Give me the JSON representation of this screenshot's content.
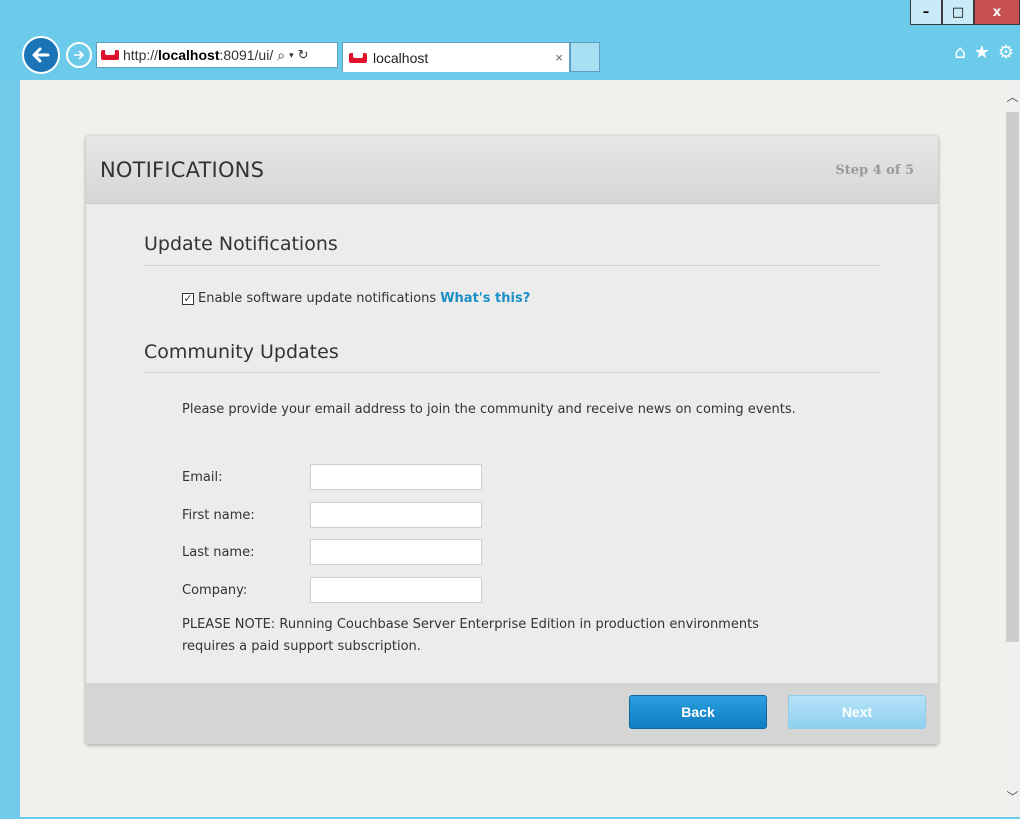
{
  "browser": {
    "address_prefix": "http://",
    "address_host": "localhost",
    "address_rest": ":8091/ui/",
    "search_icon": "magnifier-icon",
    "tab_title": "localhost",
    "tab_close": "×",
    "window_controls": {
      "minimize": "–",
      "maximize": "□",
      "close": "x"
    }
  },
  "dialog": {
    "title": "NOTIFICATIONS",
    "step": "Step 4 of 5",
    "update_section": {
      "title": "Update Notifications",
      "checkbox_label": "Enable software update notifications",
      "checkbox_checked": true,
      "link": "What's this?"
    },
    "community_section": {
      "title": "Community Updates",
      "description": "Please provide your email address to join the community and receive news on coming events.",
      "fields": [
        {
          "label": "Email:",
          "value": ""
        },
        {
          "label": "First name:",
          "value": ""
        },
        {
          "label": "Last name:",
          "value": ""
        },
        {
          "label": "Company:",
          "value": ""
        }
      ],
      "note": "PLEASE NOTE: Running Couchbase Server Enterprise Edition in production environments requires a paid support subscription."
    },
    "buttons": {
      "back": "Back",
      "next": "Next"
    }
  },
  "colors": {
    "accent": "#1a8fc7",
    "primary_button": "#1787cc",
    "disabled_button": "#9fd8f3",
    "chrome": "#6ccbea"
  }
}
